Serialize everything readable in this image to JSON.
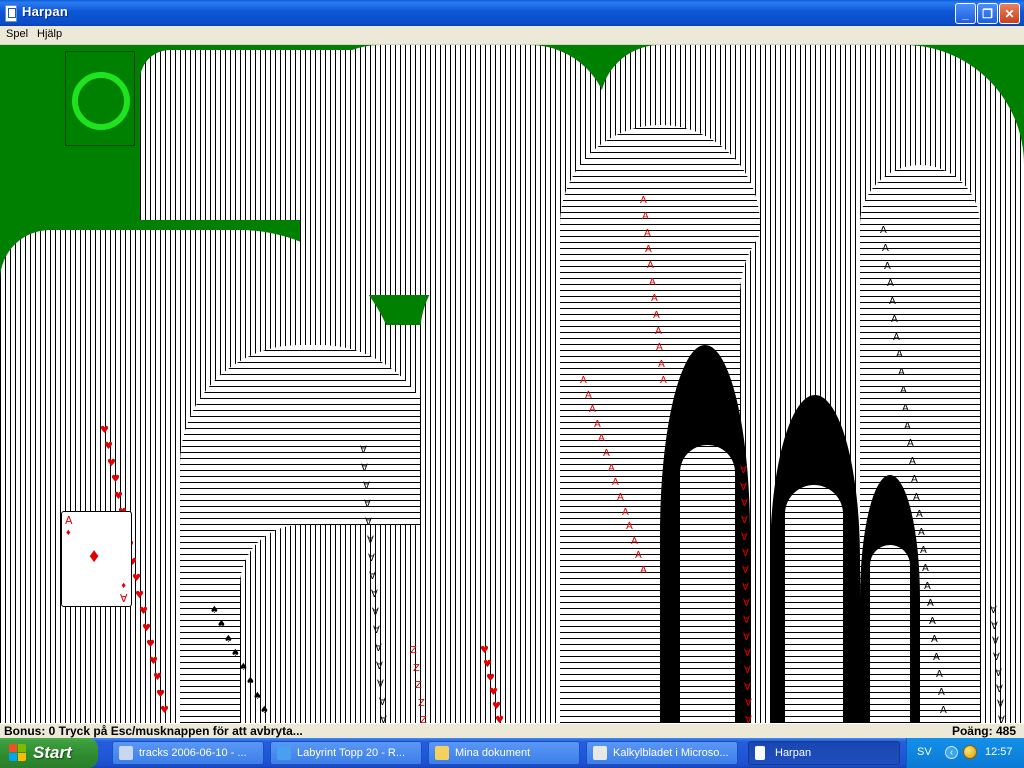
{
  "window": {
    "title": "Harpan",
    "controls": {
      "minimize": "_",
      "maximize": "❐",
      "close": "✕"
    }
  },
  "menu": {
    "items": [
      "Spel",
      "Hjälp"
    ]
  },
  "game": {
    "stock_icon": "redeal-circle-icon",
    "moving_card": {
      "rank": "A",
      "suit": "♦"
    },
    "cascade_glyphs": {
      "heart": "♥",
      "spade": "♠",
      "ace": "A",
      "ace_inverted": "∀",
      "two_inverted": "Z"
    }
  },
  "status": {
    "message": "Bonus: 0  Tryck på Esc/musknappen för att avbryta...",
    "score": "Poäng: 485"
  },
  "taskbar": {
    "start_label": "Start",
    "tasks": [
      {
        "label": "tracks 2006-06-10 - ...",
        "icon": "media-icon",
        "active": false
      },
      {
        "label": "Labyrint Topp 20 - R...",
        "icon": "browser-icon",
        "active": false
      },
      {
        "label": "Mina dokument",
        "icon": "folder-icon",
        "active": false
      },
      {
        "label": "Kalkylbladet i Microso...",
        "icon": "document-icon",
        "active": false
      },
      {
        "label": "Harpan",
        "icon": "cards-icon",
        "active": true
      }
    ],
    "tray": {
      "language": "SV",
      "clock": "12:57"
    }
  },
  "colors": {
    "felt": "#008000",
    "redeal_ring": "#1fe31f",
    "red_suit": "#e00000"
  }
}
